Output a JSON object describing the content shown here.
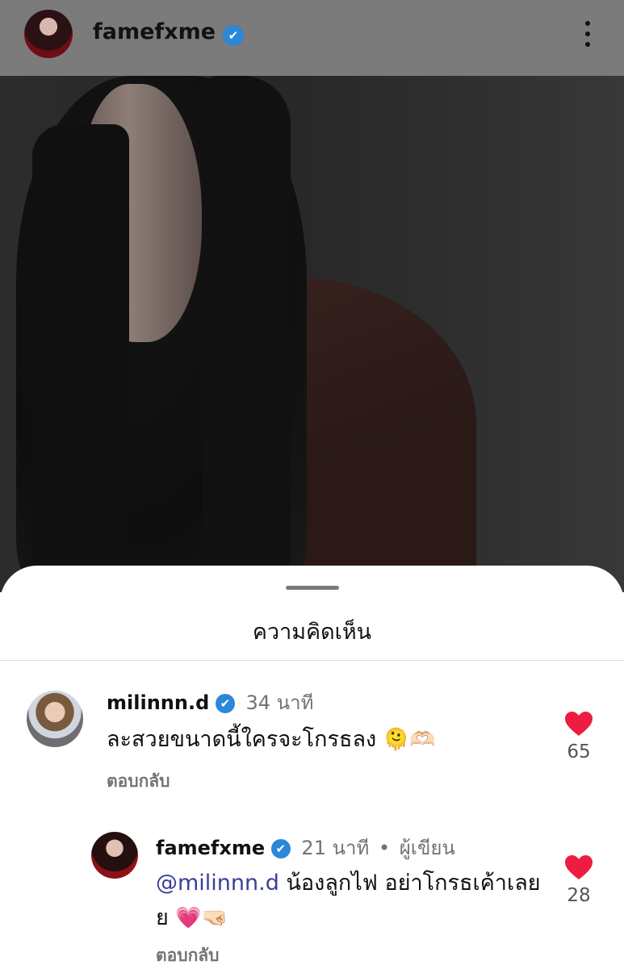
{
  "header": {
    "username": "famefxme",
    "verified_mark": "✔",
    "more_icon": "more-vertical-icon"
  },
  "sheet": {
    "title": "ความคิดเห็น"
  },
  "comments": [
    {
      "username": "milinnn.d",
      "verified_mark": "✔",
      "time": "34 นาที",
      "text": "ละสวยขนาดนี้ใครจะโกรธลง",
      "emojis": "🫠🫶🏻",
      "reply_label": "ตอบกลับ",
      "likes": "65"
    },
    {
      "username": "famefxme",
      "verified_mark": "✔",
      "time": "21 นาที",
      "author_label": "ผู้เขียน",
      "mention": "@milinnn.d",
      "text": " น้องลูกไฟ อย่าโกรธเค้าเลยย",
      "emojis": "💗🤜🏻",
      "reply_label": "ตอบกลับ",
      "likes": "28"
    }
  ],
  "colors": {
    "heart": "#ed1c40",
    "verified": "#2b87d8",
    "mention": "#3c3f99"
  }
}
